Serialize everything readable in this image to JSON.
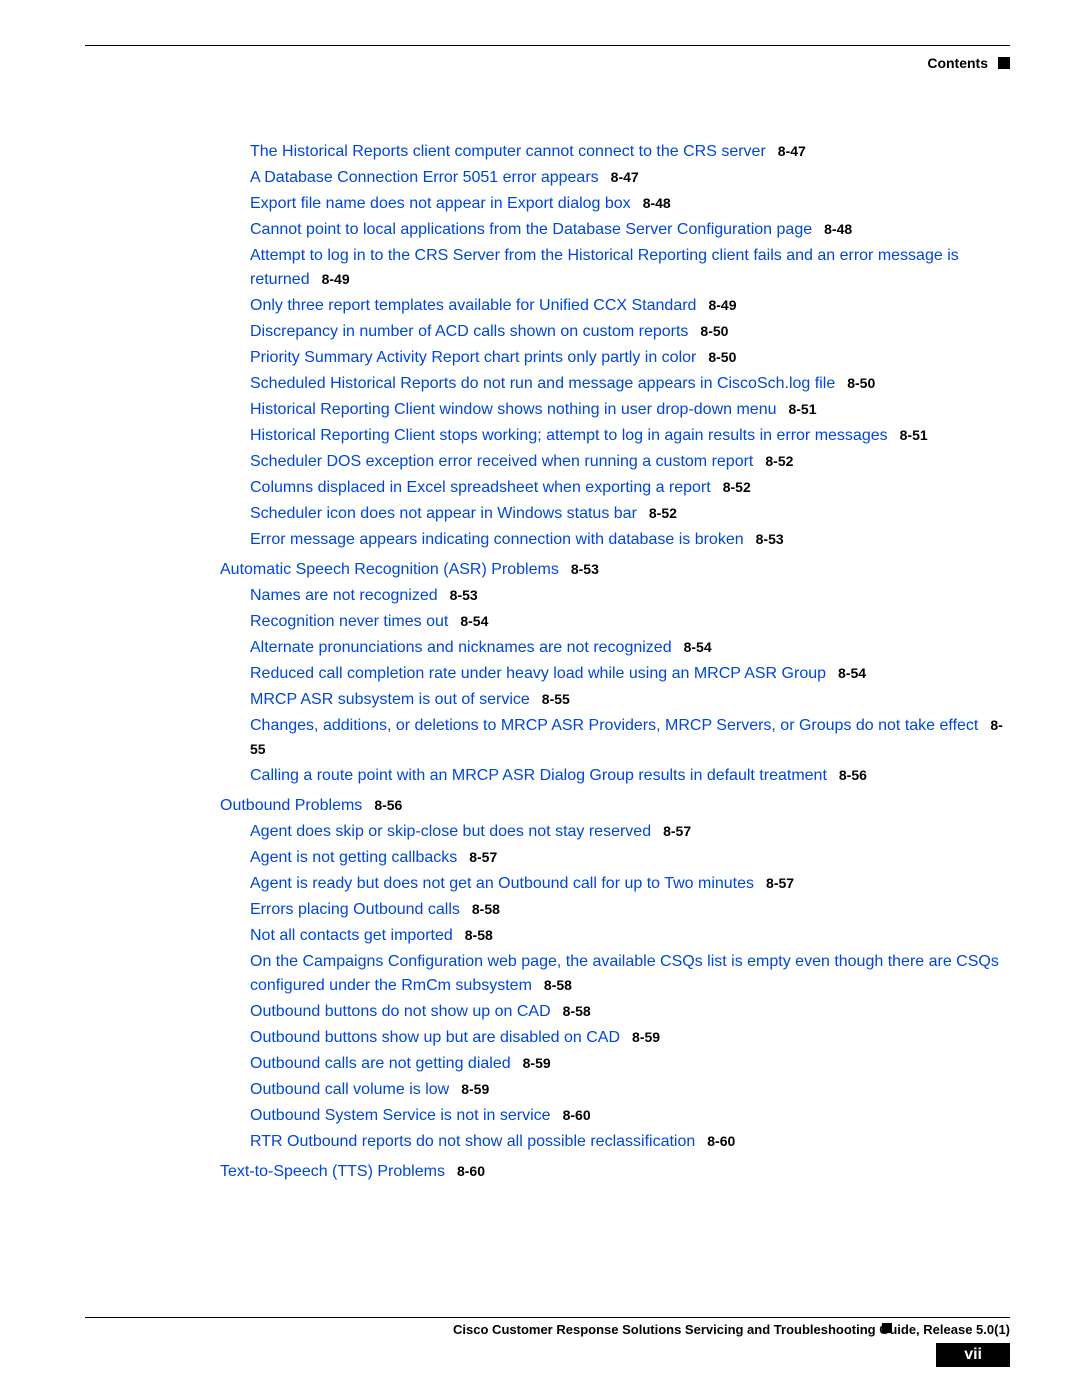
{
  "header_label": "Contents",
  "sections": [
    {
      "header": null,
      "items": [
        {
          "text": "The Historical Reports client computer cannot connect to the CRS server",
          "page": "8-47"
        },
        {
          "text": "A Database Connection Error 5051 error appears",
          "page": "8-47"
        },
        {
          "text": "Export file name does not appear in Export dialog box",
          "page": "8-48"
        },
        {
          "text": "Cannot point to local applications from the Database Server Configuration page",
          "page": "8-48"
        },
        {
          "text": "Attempt to log in to the CRS Server from the Historical Reporting client fails and an error message is returned",
          "page": "8-49"
        },
        {
          "text": "Only three report templates available for Unified CCX Standard",
          "page": "8-49"
        },
        {
          "text": "Discrepancy in number of ACD calls shown on custom reports",
          "page": "8-50"
        },
        {
          "text": "Priority Summary Activity Report chart prints only partly in color",
          "page": "8-50"
        },
        {
          "text": "Scheduled Historical Reports do not run and message appears in CiscoSch.log file",
          "page": "8-50"
        },
        {
          "text": "Historical Reporting Client window shows nothing in user drop-down menu",
          "page": "8-51"
        },
        {
          "text": "Historical Reporting Client stops working; attempt to log in again results in error messages",
          "page": "8-51"
        },
        {
          "text": "Scheduler DOS exception error received when running a custom report",
          "page": "8-52"
        },
        {
          "text": "Columns displaced in Excel spreadsheet when exporting a report",
          "page": "8-52"
        },
        {
          "text": "Scheduler icon does not appear in Windows status bar",
          "page": "8-52"
        },
        {
          "text": "Error message appears indicating connection with database is broken",
          "page": "8-53"
        }
      ]
    },
    {
      "header": {
        "text": "Automatic Speech Recognition (ASR) Problems",
        "page": "8-53"
      },
      "items": [
        {
          "text": "Names are not recognized",
          "page": "8-53"
        },
        {
          "text": "Recognition never times out",
          "page": "8-54"
        },
        {
          "text": "Alternate pronunciations and nicknames are not recognized",
          "page": "8-54"
        },
        {
          "text": "Reduced call completion rate under heavy load while using an MRCP ASR Group",
          "page": "8-54"
        },
        {
          "text": "MRCP ASR subsystem is out of service",
          "page": "8-55"
        },
        {
          "text": "Changes, additions, or deletions to MRCP ASR Providers, MRCP Servers, or Groups do not take effect",
          "page": "8-55"
        },
        {
          "text": "Calling a route point with an MRCP ASR Dialog Group results in default treatment",
          "page": "8-56"
        }
      ]
    },
    {
      "header": {
        "text": "Outbound Problems",
        "page": "8-56"
      },
      "items": [
        {
          "text": "Agent does skip or skip-close but does not stay reserved",
          "page": "8-57"
        },
        {
          "text": "Agent is not getting callbacks",
          "page": "8-57"
        },
        {
          "text": "Agent is ready but does not get an Outbound call for up to Two minutes",
          "page": "8-57"
        },
        {
          "text": "Errors placing Outbound calls",
          "page": "8-58"
        },
        {
          "text": "Not all contacts get imported",
          "page": "8-58"
        },
        {
          "text": "On the Campaigns Configuration web page, the available CSQs list is empty even though there are CSQs configured under the RmCm subsystem",
          "page": "8-58"
        },
        {
          "text": "Outbound buttons do not show up on CAD",
          "page": "8-58"
        },
        {
          "text": "Outbound buttons show up but are disabled on CAD",
          "page": "8-59"
        },
        {
          "text": "Outbound calls are not getting dialed",
          "page": "8-59"
        },
        {
          "text": "Outbound call volume is low",
          "page": "8-59"
        },
        {
          "text": "Outbound System Service is not in service",
          "page": "8-60"
        },
        {
          "text": "RTR Outbound reports do not show all possible reclassification",
          "page": "8-60"
        }
      ]
    },
    {
      "header": {
        "text": "Text-to-Speech (TTS) Problems",
        "page": "8-60"
      },
      "items": []
    }
  ],
  "footer_text": "Cisco Customer Response Solutions Servicing and Troubleshooting Guide, Release 5.0(1)",
  "page_number": "vii"
}
